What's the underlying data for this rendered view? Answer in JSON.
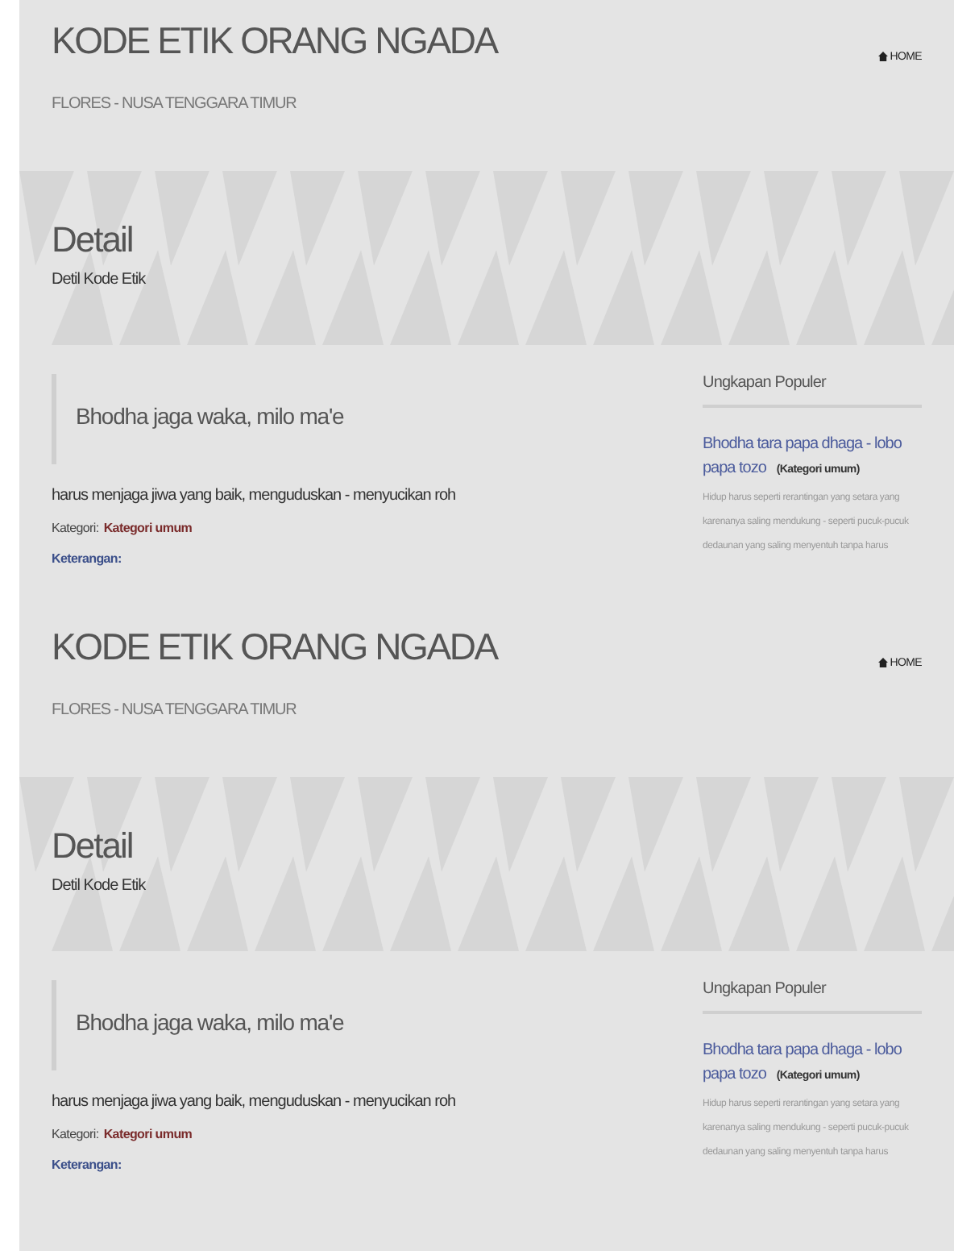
{
  "sections": [
    {
      "header": {
        "title": "KODE ETIK ORANG NGADA",
        "subtitle": "FLORES - NUSA TENGGARA TIMUR",
        "home": "HOME"
      },
      "banner": {
        "title": "Detail",
        "subtitle": "Detil Kode Etik"
      },
      "quote": "Bhodha jaga waka, milo ma'e",
      "meaning": "harus menjaga jiwa yang baik, menguduskan - menyucikan roh",
      "category_label": "Kategori:",
      "category_value": "Kategori umum",
      "notes_label": "Keterangan:",
      "sidebar": {
        "heading": "Ungkapan Populer",
        "items": [
          {
            "title": "Bhodha tara papa dhaga - lobo papa tozo",
            "category": "(Kategori umum)",
            "excerpt": "Hidup harus seperti rerantingan yang setara yang karenanya saling mendukung - seperti pucuk-pucuk dedaunan yang saling menyentuh tanpa harus"
          }
        ]
      }
    },
    {
      "header": {
        "title": "KODE ETIK ORANG NGADA",
        "subtitle": "FLORES - NUSA TENGGARA TIMUR",
        "home": "HOME"
      },
      "banner": {
        "title": "Detail",
        "subtitle": "Detil Kode Etik"
      },
      "quote": "Bhodha jaga waka, milo ma'e",
      "meaning": "harus menjaga jiwa yang baik, menguduskan - menyucikan roh",
      "category_label": "Kategori:",
      "category_value": "Kategori umum",
      "notes_label": "Keterangan:",
      "sidebar": {
        "heading": "Ungkapan Populer",
        "items": [
          {
            "title": "Bhodha tara papa dhaga - lobo papa tozo",
            "category": "(Kategori umum)",
            "excerpt": "Hidup harus seperti rerantingan yang setara yang karenanya saling mendukung - seperti pucuk-pucuk dedaunan yang saling menyentuh tanpa harus"
          }
        ]
      }
    }
  ]
}
